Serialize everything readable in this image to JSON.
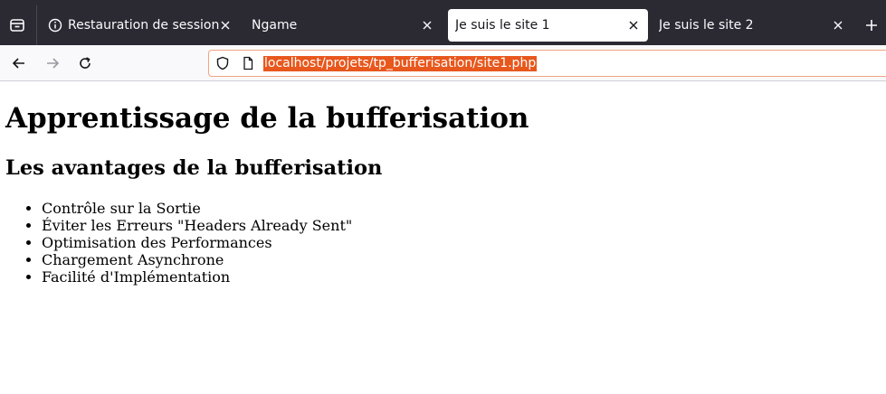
{
  "browser": {
    "tabs": [
      {
        "label": "Restauration de session",
        "selected": false,
        "icon": "info-icon"
      },
      {
        "label": "Ngame",
        "selected": false
      },
      {
        "label": "Je suis le site 1",
        "selected": true
      },
      {
        "label": "Je suis le site 2",
        "selected": false
      }
    ],
    "url": "localhost/projets/tp_bufferisation/site1.php"
  },
  "page": {
    "title": "Apprentissage de la bufferisation",
    "subtitle": "Les avantages de la bufferisation",
    "items": [
      "Contrôle sur la Sortie",
      "Éviter les Erreurs \"Headers Already Sent\"",
      "Optimisation des Performances",
      "Chargement Asynchrone",
      "Facilité d'Implémentation"
    ]
  },
  "colors": {
    "tabbar_bg": "#2b2a33",
    "url_highlight": "#e8571c",
    "url_border": "#f0a582"
  }
}
